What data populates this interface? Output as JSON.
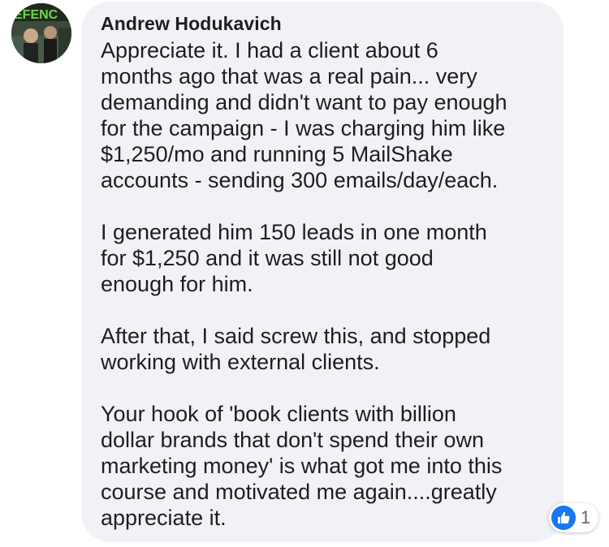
{
  "comment": {
    "author": "Andrew Hodukavich",
    "avatar_text": "EFENC",
    "paragraphs": [
      [
        "Appreciate it. I had a client about 6",
        "months ago that was a real pain... very",
        "demanding and didn't want to pay enough",
        "for the campaign - I was charging him like",
        "$1,250/mo and running 5 MailShake",
        "accounts - sending 300 emails/day/each."
      ],
      [
        "I generated him 150 leads in one month",
        "for $1,250 and it was still not good",
        "enough for him."
      ],
      [
        "After that, I said screw this, and stopped",
        "working with external clients."
      ],
      [
        "Your hook of 'book clients with billion",
        "dollar brands that don't spend their own",
        "marketing money' is what got me into this",
        "course and motivated me again....greatly",
        "appreciate it."
      ]
    ],
    "reactions": {
      "icon": "like-icon",
      "count": "1",
      "color": "#1877f2"
    }
  }
}
